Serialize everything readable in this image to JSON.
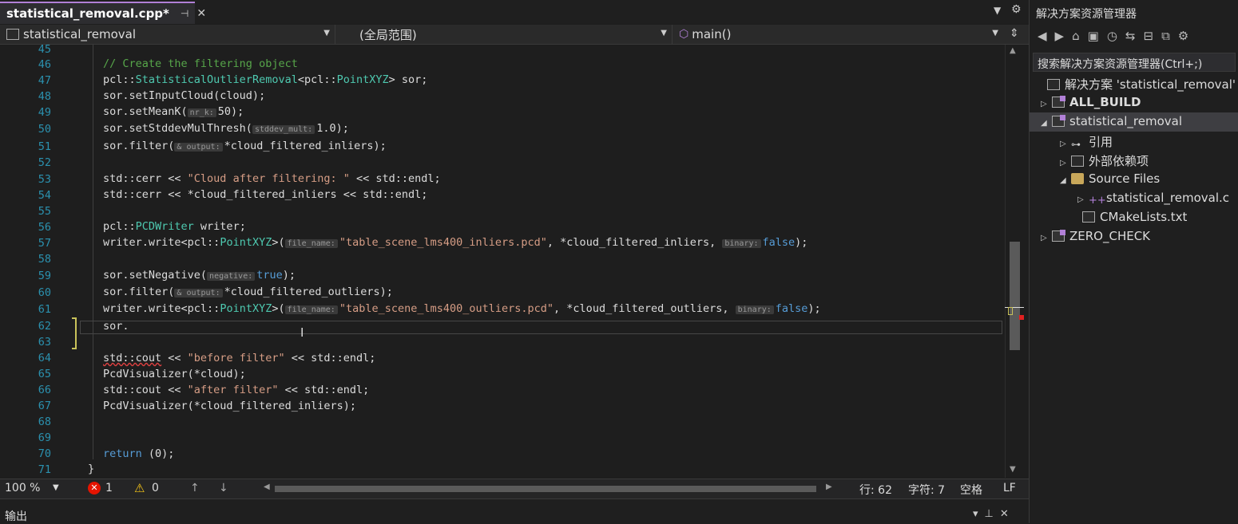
{
  "tab": {
    "title": "statistical_removal.cpp*",
    "pin_icon": "pin-icon",
    "close_icon": "close-icon"
  },
  "navbar": {
    "project": "statistical_removal",
    "scope": "(全局范围)",
    "function": "main()"
  },
  "editor": {
    "lines": [
      {
        "n": "45",
        "text": ""
      },
      {
        "n": "46",
        "text": ""
      },
      {
        "n": "47",
        "text": ""
      },
      {
        "n": "48",
        "text": ""
      },
      {
        "n": "49",
        "text": ""
      },
      {
        "n": "50",
        "text": ""
      },
      {
        "n": "51",
        "text": ""
      },
      {
        "n": "52",
        "text": ""
      },
      {
        "n": "53",
        "text": ""
      },
      {
        "n": "54",
        "text": ""
      },
      {
        "n": "55",
        "text": ""
      },
      {
        "n": "56",
        "text": ""
      },
      {
        "n": "57",
        "text": ""
      },
      {
        "n": "58",
        "text": ""
      },
      {
        "n": "59",
        "text": ""
      },
      {
        "n": "60",
        "text": ""
      },
      {
        "n": "61",
        "text": ""
      },
      {
        "n": "62",
        "text": ""
      },
      {
        "n": "63",
        "text": ""
      },
      {
        "n": "64",
        "text": ""
      },
      {
        "n": "65",
        "text": ""
      },
      {
        "n": "66",
        "text": ""
      },
      {
        "n": "67",
        "text": ""
      },
      {
        "n": "68",
        "text": ""
      },
      {
        "n": "69",
        "text": ""
      },
      {
        "n": "70",
        "text": ""
      },
      {
        "n": "71",
        "text": ""
      }
    ],
    "code": {
      "l46": "// Create the filtering object",
      "l47a": "pcl::",
      "l47b": "StatisticalOutlierRemoval",
      "l47c": "<pcl::",
      "l47d": "PointXYZ",
      "l47e": "> sor;",
      "l48": "sor.setInputCloud(cloud);",
      "l49a": "sor.setMeanK(",
      "l49h": "nr_k:",
      "l49b": "50);",
      "l50a": "sor.setStddevMulThresh(",
      "l50h": "stddev_mult:",
      "l50b": "1.0);",
      "l51a": "sor.filter(",
      "l51h": "& output:",
      "l51b": "*cloud_filtered_inliers);",
      "l53a": "std::cerr << ",
      "l53s": "\"Cloud after filtering: \"",
      "l53b": " << std::endl;",
      "l54": "std::cerr << *cloud_filtered_inliers << std::endl;",
      "l56a": "pcl::",
      "l56b": "PCDWriter",
      "l56c": " writer;",
      "l57a": "writer.write<pcl::",
      "l57t": "PointXYZ",
      "l57b": ">(",
      "l57h": "file_name:",
      "l57s": "\"table_scene_lms400_inliers.pcd\"",
      "l57c": ", *cloud_filtered_inliers, ",
      "l57h2": "binary:",
      "l57k": "false",
      "l57d": ");",
      "l59a": "sor.setNegative(",
      "l59h": "negative:",
      "l59k": "true",
      "l59b": ");",
      "l60a": "sor.filter(",
      "l60h": "& output:",
      "l60b": "*cloud_filtered_outliers);",
      "l61a": "writer.write<pcl::",
      "l61t": "PointXYZ",
      "l61b": ">(",
      "l61h": "file_name:",
      "l61s": "\"table_scene_lms400_outliers.pcd\"",
      "l61c": ", *cloud_filtered_outliers, ",
      "l61h2": "binary:",
      "l61k": "false",
      "l61d": ");",
      "l62": "sor.",
      "l64a": "std::cout",
      "l64b": " << ",
      "l64s": "\"before filter\"",
      "l64c": " << std::endl;",
      "l65": "PcdVisualizer(*cloud);",
      "l66a": "std::cout << ",
      "l66s": "\"after filter\"",
      "l66b": " << std::endl;",
      "l67": "PcdVisualizer(*cloud_filtered_inliers);",
      "l70a": "return",
      "l70b": " (0);",
      "l71": "}"
    }
  },
  "statusbar": {
    "zoom": "100 %",
    "errors": "1",
    "warnings": "0",
    "row": "行: 62",
    "col": "字符: 7",
    "spaces": "空格",
    "eol": "LF"
  },
  "output_panel": {
    "title": "输出"
  },
  "solution_explorer": {
    "title": "解决方案资源管理器",
    "search_placeholder": "搜索解决方案资源管理器(Ctrl+;)",
    "solution": "解决方案 'statistical_removal' (",
    "items": [
      {
        "label": "ALL_BUILD"
      },
      {
        "label": "statistical_removal"
      },
      {
        "label": "引用"
      },
      {
        "label": "外部依赖项"
      },
      {
        "label": "Source Files"
      },
      {
        "label": "statistical_removal.c"
      },
      {
        "label": "CMakeLists.txt"
      },
      {
        "label": "ZERO_CHECK"
      }
    ]
  },
  "colors": {
    "accent": "#b180d7",
    "keyword": "#569cd6",
    "type": "#4ec9b0",
    "comment": "#57a64a",
    "string": "#d69d85",
    "linenum": "#2b91af"
  }
}
